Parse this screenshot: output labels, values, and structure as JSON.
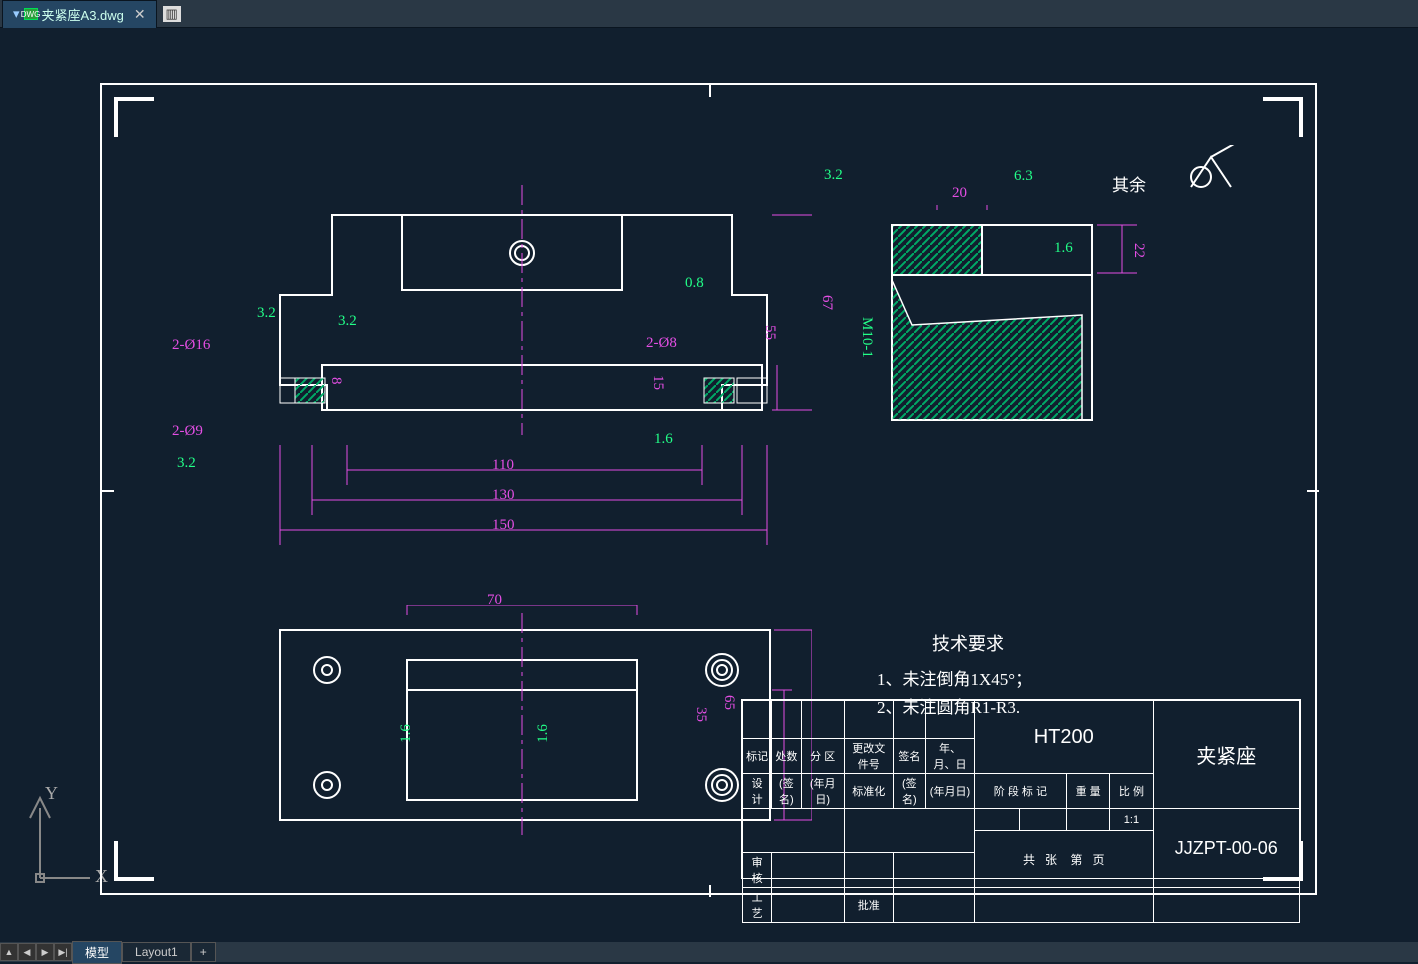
{
  "tab": {
    "filename": "夹紧座A3.dwg",
    "dwg_badge": "DWG"
  },
  "bottom_tabs": {
    "model": "模型",
    "layout1": "Layout1",
    "add": "+"
  },
  "ucs": {
    "x": "X",
    "y": "Y"
  },
  "dimensions": {
    "d110": "110",
    "d130": "130",
    "d150": "150",
    "d70": "70",
    "d20": "20",
    "d22": "22",
    "d67": "67",
    "d55": "55",
    "d15": "15",
    "d8": "8",
    "d35": "35",
    "d65": "65",
    "d2phi16": "2-Ø16",
    "d2phi9": "2-Ø9",
    "d2phi8": "2-Ø8",
    "M10": "M10-1",
    "s32a": "3.2",
    "s32b": "3.2",
    "s32c": "3.2",
    "s32d": "3.2",
    "s63": "6.3",
    "s08": "0.8",
    "s16a": "1.6",
    "s16b": "1.6",
    "s16c": "1.6",
    "s16d": "1.6",
    "qiyu": "其余"
  },
  "tech_req": {
    "heading": "技术要求",
    "line1": "1、未注倒角1X45°；",
    "line2": "2、未注圆角R1-R3."
  },
  "title_block": {
    "material": "HT200",
    "part_name": "夹紧座",
    "drawing_no": "JJZPT-00-06",
    "biaoji": "标记",
    "chushu": "处数",
    "fenqu": "分  区",
    "genggai": "更改文件号",
    "qianming": "签名",
    "nianyueri": "年、月、日",
    "sheji": "设  计",
    "qm": "(签名)",
    "nyr": "(年月日)",
    "biaozhunhua": "标准化",
    "shenhe": "审  核",
    "gongyi": "工  艺",
    "pizhun": "批准",
    "jieduan": "阶  段  标  记",
    "zhongliang": "重  量",
    "bili": "比  例",
    "scale": "1:1",
    "gong": "共",
    "zhang": "张",
    "di": "第",
    "ye": "页"
  }
}
